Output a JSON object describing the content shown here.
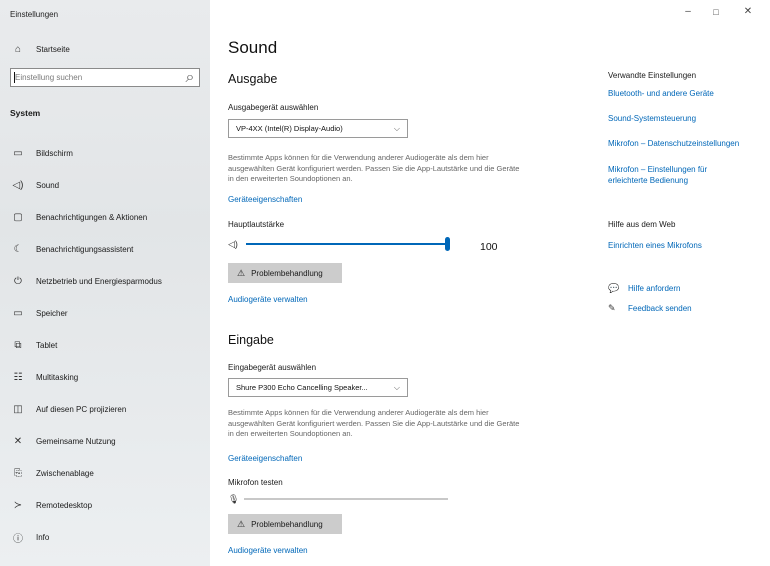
{
  "window": {
    "title": "Einstellungen",
    "minimize_icon": "–",
    "maximize_icon": "□",
    "close_icon": "✕"
  },
  "sidebar": {
    "home": {
      "label": "Startseite",
      "icon": "home-icon",
      "glyph": "⌂"
    },
    "search_placeholder": "Einstellung suchen",
    "search_icon": "⌕",
    "section": "System",
    "items": [
      {
        "label": "Bildschirm",
        "icon": "monitor-icon",
        "glyph": "▭"
      },
      {
        "label": "Sound",
        "icon": "speaker-icon",
        "glyph": "◁)",
        "selected": true
      },
      {
        "label": "Benachrichtigungen & Aktionen",
        "icon": "notification-icon",
        "glyph": "▢"
      },
      {
        "label": "Benachrichtigungsassistent",
        "icon": "moon-icon",
        "glyph": "☾"
      },
      {
        "label": "Netzbetrieb und Energiesparmodus",
        "icon": "power-icon",
        "glyph": "⏻"
      },
      {
        "label": "Speicher",
        "icon": "storage-icon",
        "glyph": "▭"
      },
      {
        "label": "Tablet",
        "icon": "tablet-icon",
        "glyph": "⧉"
      },
      {
        "label": "Multitasking",
        "icon": "multitasking-icon",
        "glyph": "☷"
      },
      {
        "label": "Auf diesen PC projizieren",
        "icon": "project-icon",
        "glyph": "◫"
      },
      {
        "label": "Gemeinsame Nutzung",
        "icon": "share-icon",
        "glyph": "✕"
      },
      {
        "label": "Zwischenablage",
        "icon": "clipboard-icon",
        "glyph": "⎘"
      },
      {
        "label": "Remotedesktop",
        "icon": "remote-icon",
        "glyph": "≻"
      },
      {
        "label": "Info",
        "icon": "info-icon",
        "glyph": "ⓘ"
      }
    ]
  },
  "main": {
    "title": "Sound",
    "output": {
      "heading": "Ausgabe",
      "device_label": "Ausgabegerät auswählen",
      "device_value": "VP-4XX (Intel(R) Display-Audio)",
      "description": "Bestimmte Apps können für die Verwendung anderer Audiogeräte als dem hier ausgewählten Gerät konfiguriert werden. Passen Sie die App-Lautstärke und die Geräte in den erweiterten Soundoptionen an.",
      "properties_link": "Geräteeigenschaften",
      "volume_label": "Hauptlautstärke",
      "volume_value": "100",
      "volume_fraction": 1.0,
      "troubleshoot": "Problembehandlung",
      "manage_link": "Audiogeräte verwalten"
    },
    "input": {
      "heading": "Eingabe",
      "device_label": "Eingabegerät auswählen",
      "device_value": "Shure P300 Echo Cancelling Speaker...",
      "description": "Bestimmte Apps können für die Verwendung anderer Audiogeräte als dem hier ausgewählten Gerät konfiguriert werden. Passen Sie die App-Lautstärke und die Geräte in den erweiterten Soundoptionen an.",
      "properties_link": "Geräteeigenschaften",
      "test_label": "Mikrofon testen",
      "mic_level_fraction": 0.0,
      "troubleshoot": "Problembehandlung",
      "manage_link": "Audiogeräte verwalten"
    }
  },
  "right": {
    "related_heading": "Verwandte Einstellungen",
    "related_links": [
      "Bluetooth- und andere Geräte",
      "Sound-Systemsteuerung",
      "Mikrofon – Datenschutzeinstellungen",
      "Mikrofon – Einstellungen für erleichterte Bedienung"
    ],
    "help_heading": "Hilfe aus dem Web",
    "help_link": "Einrichten eines Mikrofons",
    "get_help": "Hilfe anfordern",
    "feedback": "Feedback senden"
  }
}
